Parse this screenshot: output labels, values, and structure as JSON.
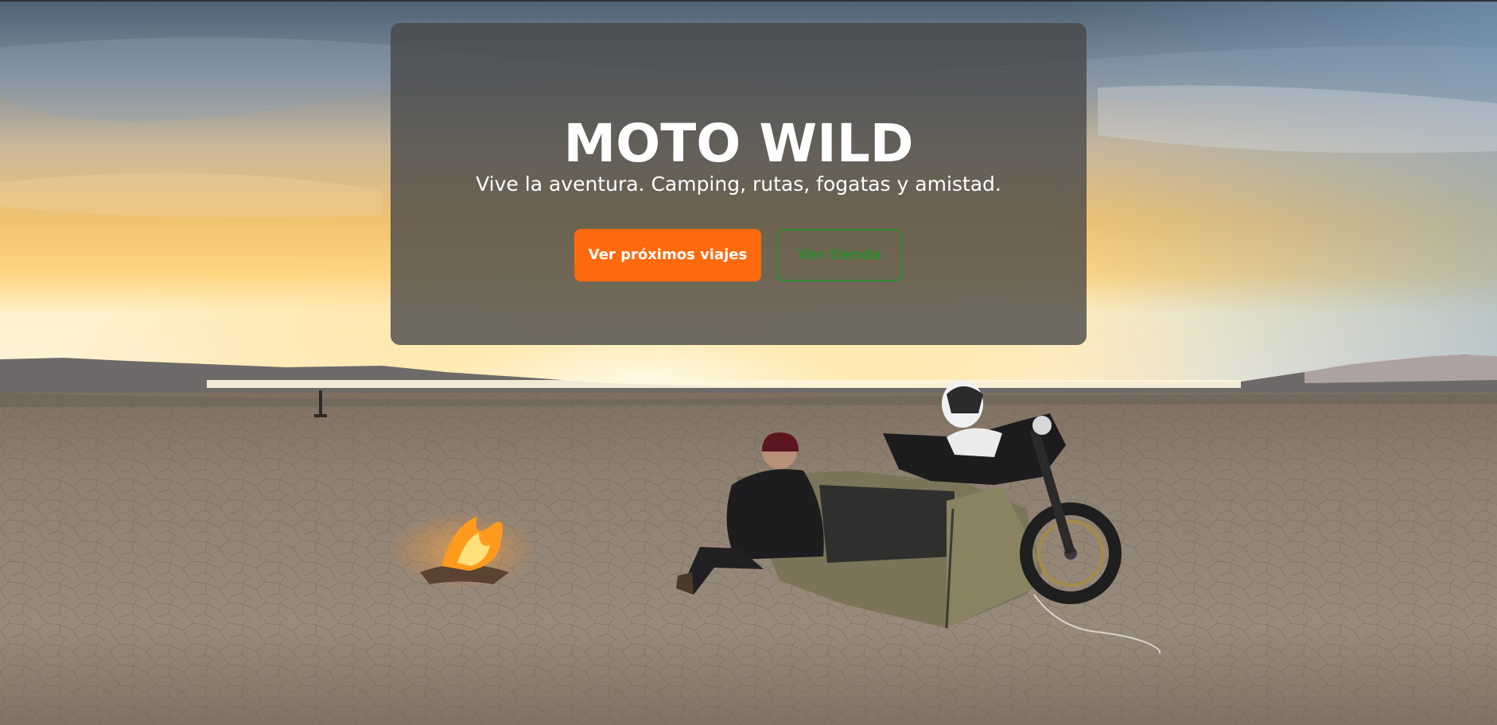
{
  "hero": {
    "title": "MOTO WILD",
    "subtitle": "Vive la aventura. Camping, rutas, fogatas y amistad.",
    "primary_button": "Ver próximos viajes",
    "secondary_button": "Ver tienda"
  },
  "colors": {
    "primary_accent": "#ff6a0e",
    "secondary_accent": "#2e8b2e",
    "card_overlay": "#464646"
  }
}
